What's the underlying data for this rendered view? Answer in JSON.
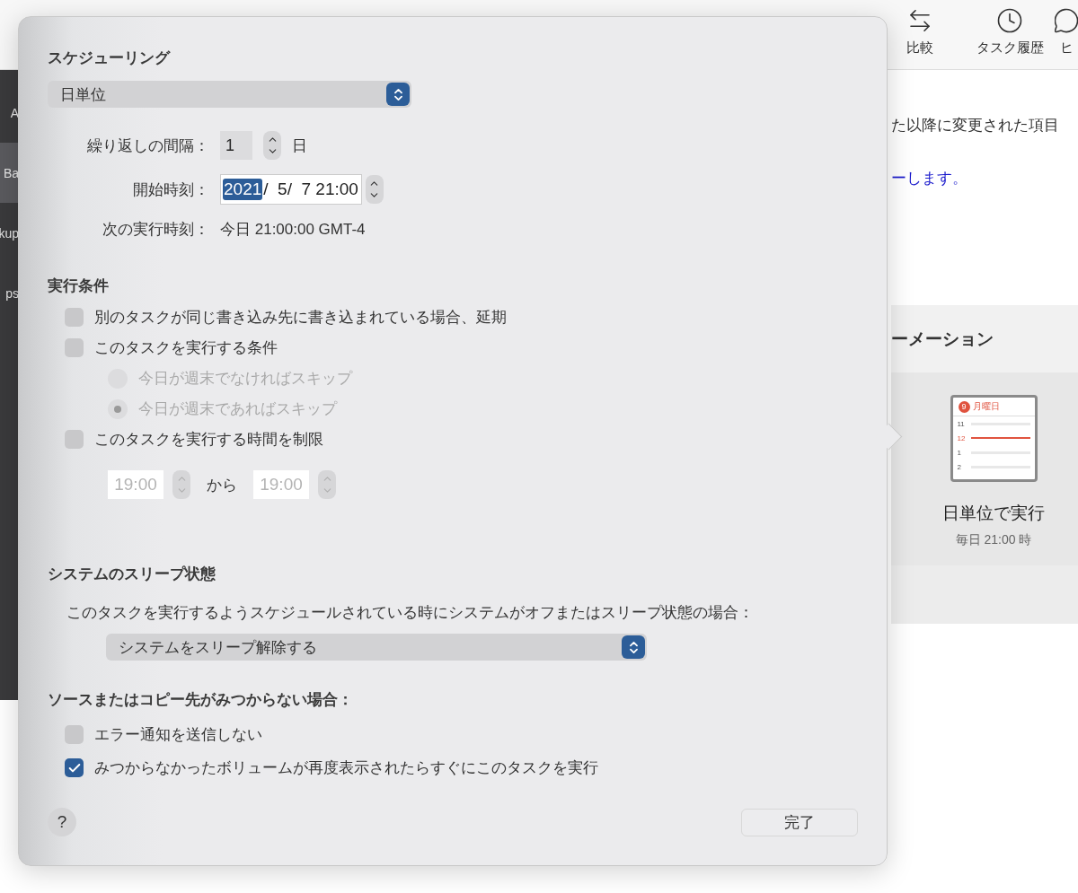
{
  "background_app": {
    "toolbar": [
      {
        "kind": "compare",
        "label": "比較"
      },
      {
        "kind": "history",
        "label": "タスク履歴"
      },
      {
        "kind": "help",
        "label": "ヒ"
      }
    ],
    "sidebar_items": [
      {
        "label": "A",
        "selected": false
      },
      {
        "label": "Ba",
        "selected": true
      },
      {
        "label": "kup",
        "selected": false
      },
      {
        "label": "ps",
        "selected": false
      }
    ],
    "description": "た以降に変更された項目",
    "link": "ーします。",
    "automation": {
      "heading": "ーメーション",
      "calendar": {
        "day": "9",
        "weekday": "月曜日",
        "hours": [
          {
            "label": "11",
            "current": false
          },
          {
            "label": "12",
            "current": true
          },
          {
            "label": "1",
            "current": false
          },
          {
            "label": "2",
            "current": false
          }
        ]
      },
      "title": "日単位で実行",
      "subtitle": "毎日 21:00 時"
    }
  },
  "popover": {
    "scheduling": {
      "heading": "スケジューリング",
      "frequency": "日単位",
      "interval": {
        "label": "繰り返しの間隔：",
        "value": "1",
        "unit": "日"
      },
      "start": {
        "label": "開始時刻：",
        "segments": [
          {
            "text": "2021",
            "selected": true
          },
          {
            "text": "/  5/  7 21:00",
            "selected": false
          }
        ]
      },
      "next_run": {
        "label": "次の実行時刻：",
        "value": "今日 21:00:00 GMT-4"
      }
    },
    "conditions": {
      "heading": "実行条件",
      "options": [
        {
          "kind": "checkbox",
          "label": "別のタスクが同じ書き込み先に書き込まれている場合、延期",
          "checked": false
        },
        {
          "kind": "checkbox",
          "label": "このタスクを実行する条件",
          "checked": false
        },
        {
          "kind": "radio_group",
          "disabled": true,
          "choices": [
            {
              "label": "今日が週末でなければスキップ",
              "selected": false
            },
            {
              "label": "今日が週末であればスキップ",
              "selected": true
            }
          ]
        },
        {
          "kind": "checkbox",
          "label": "このタスクを実行する時間を制限",
          "checked": false
        },
        {
          "kind": "time_range",
          "disabled": true,
          "from": "19:00",
          "separator": "から",
          "to": "19:00"
        }
      ]
    },
    "sleep": {
      "heading": "システムのスリープ状態",
      "description": "このタスクを実行するようスケジュールされている時にシステムがオフまたはスリープ状態の場合：",
      "action": "システムをスリープ解除する"
    },
    "missing": {
      "heading": "ソースまたはコピー先がみつからない場合：",
      "options": [
        {
          "label": "エラー通知を送信しない",
          "checked": false
        },
        {
          "label": "みつからなかったボリュームが再度表示されたらすぐにこのタスクを実行",
          "checked": true
        }
      ]
    },
    "footer": {
      "help": "?",
      "done": "完了"
    }
  }
}
